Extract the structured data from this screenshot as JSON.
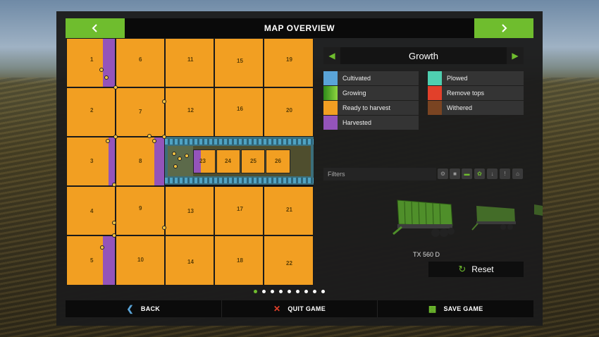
{
  "header": {
    "title": "MAP OVERVIEW",
    "prev_icon": "chevron-left-icon",
    "next_icon": "chevron-right-icon"
  },
  "map": {
    "fields": [
      {
        "num": "1"
      },
      {
        "num": "2"
      },
      {
        "num": "3"
      },
      {
        "num": "4"
      },
      {
        "num": "5"
      },
      {
        "num": "6"
      },
      {
        "num": "7"
      },
      {
        "num": "8"
      },
      {
        "num": "9"
      },
      {
        "num": "10"
      },
      {
        "num": "11"
      },
      {
        "num": "12"
      },
      {
        "num": "13"
      },
      {
        "num": "14"
      },
      {
        "num": "15"
      },
      {
        "num": "16"
      },
      {
        "num": "17"
      },
      {
        "num": "18"
      },
      {
        "num": "19"
      },
      {
        "num": "20"
      },
      {
        "num": "21"
      },
      {
        "num": "22"
      },
      {
        "num": "23"
      },
      {
        "num": "24"
      },
      {
        "num": "25"
      },
      {
        "num": "26"
      }
    ]
  },
  "layer": {
    "label": "Growth"
  },
  "legend": [
    {
      "label": "Cultivated",
      "color": "#5aa4d8"
    },
    {
      "label": "Plowed",
      "color": "#4fcfb0"
    },
    {
      "label": "Growing",
      "color": "#5fbf2a"
    },
    {
      "label": "Remove tops",
      "color": "#e2402a"
    },
    {
      "label": "Ready to harvest",
      "color": "#f29f22"
    },
    {
      "label": "Withered",
      "color": "#7a4422"
    },
    {
      "label": "Harvested",
      "color": "#9454ba"
    }
  ],
  "filters": {
    "label": "Filters"
  },
  "vehicle": {
    "name": "TX 560 D"
  },
  "reset": {
    "label": "Reset"
  },
  "footer": {
    "back": "BACK",
    "quit": "QUIT GAME",
    "save": "SAVE GAME"
  },
  "colors": {
    "accent": "#6fbd2e",
    "ready": "#f29f22",
    "harvested": "#9454ba"
  }
}
